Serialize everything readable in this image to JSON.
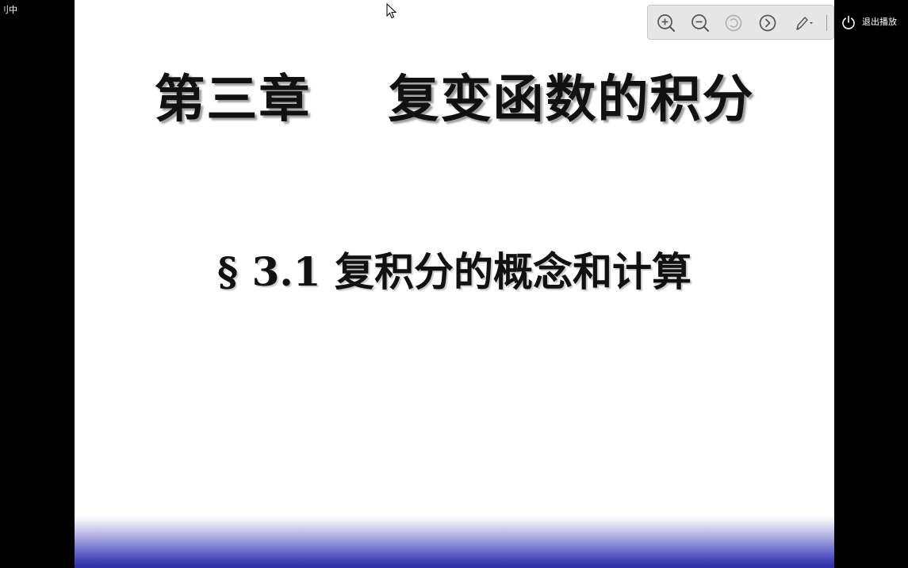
{
  "corner_label": "刂中",
  "slide": {
    "title": "第三章    复变函数的积分",
    "subtitle": "§ 3.1 复积分的概念和计算"
  },
  "toolbar": {
    "buttons": [
      {
        "icon": "zoom-in-icon",
        "enabled": true
      },
      {
        "icon": "zoom-out-icon",
        "enabled": true
      },
      {
        "icon": "reset-icon",
        "enabled": false
      },
      {
        "icon": "next-icon",
        "enabled": true
      },
      {
        "icon": "pen-icon",
        "enabled": true
      }
    ]
  },
  "exit": {
    "icon": "power-icon",
    "label": "退出播放"
  },
  "colors": {
    "background": "#000000",
    "slide": "#ffffff",
    "slide_band": "#2d2da6",
    "toolbar": "#e6e6e6",
    "icon": "#555555",
    "icon_disabled": "#b0b0b0",
    "text": "#111111"
  }
}
